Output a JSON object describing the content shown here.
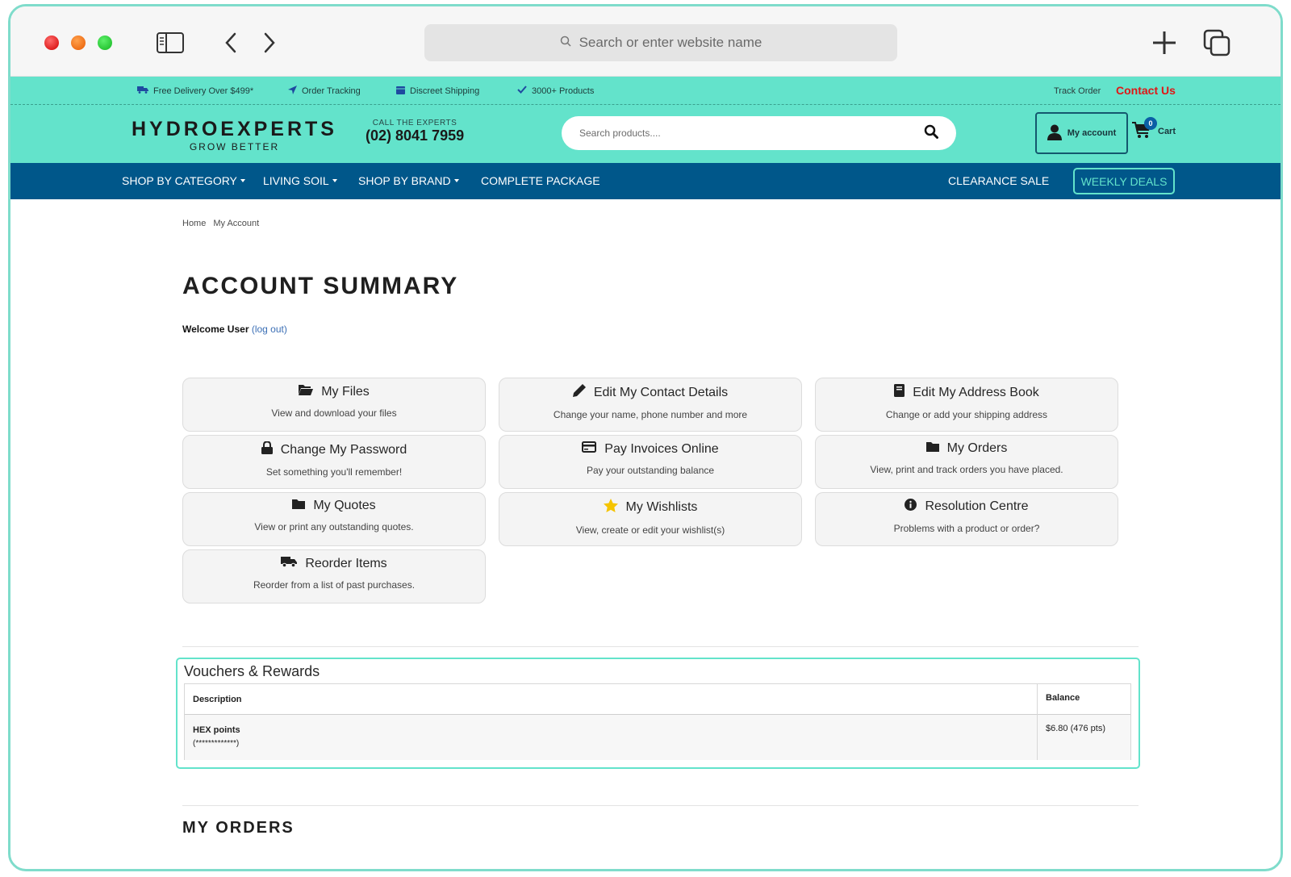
{
  "browser": {
    "address_placeholder": "Search or enter website name"
  },
  "promo": {
    "items": [
      "Free Delivery Over $499*",
      "Order Tracking",
      "Discreet Shipping",
      "3000+ Products"
    ],
    "track_order": "Track Order",
    "contact_us": "Contact Us"
  },
  "header": {
    "logo_name": "HYDROEXPERTS",
    "logo_tag": "GROW BETTER",
    "call_label": "CALL THE EXPERTS",
    "phone": "(02) 8041 7959",
    "search_placeholder": "Search products....",
    "account_label": "My account",
    "cart_label": "Cart",
    "cart_count": "0"
  },
  "nav": {
    "items": [
      "SHOP BY CATEGORY",
      "LIVING SOIL",
      "SHOP BY BRAND",
      "COMPLETE PACKAGE"
    ],
    "clearance": "CLEARANCE SALE",
    "weekly": "WEEKLY DEALS"
  },
  "breadcrumb": [
    "Home",
    "My Account"
  ],
  "page": {
    "title": "ACCOUNT SUMMARY",
    "welcome": "Welcome User",
    "logout": "(log out)"
  },
  "cards": [
    {
      "title": "My Files",
      "desc": "View and download your files",
      "icon": "folder-open-icon"
    },
    {
      "title": "Edit My Contact Details",
      "desc": "Change your name, phone number and more",
      "icon": "pencil-icon"
    },
    {
      "title": "Edit My Address Book",
      "desc": "Change or add your shipping address",
      "icon": "book-icon"
    },
    {
      "title": "Change My Password",
      "desc": "Set something you'll remember!",
      "icon": "lock-icon"
    },
    {
      "title": "Pay Invoices Online",
      "desc": "Pay your outstanding balance",
      "icon": "credit-card-icon"
    },
    {
      "title": "My Orders",
      "desc": "View, print and track orders you have placed.",
      "icon": "folder-icon"
    },
    {
      "title": "My Quotes",
      "desc": "View or print any outstanding quotes.",
      "icon": "folder-icon"
    },
    {
      "title": "My Wishlists",
      "desc": "View, create or edit your wishlist(s)",
      "icon": "star-icon"
    },
    {
      "title": "Resolution Centre",
      "desc": "Problems with a product or order?",
      "icon": "info-icon"
    },
    {
      "title": "Reorder Items",
      "desc": "Reorder from a list of past purchases.",
      "icon": "truck-icon"
    }
  ],
  "vouchers": {
    "title": "Vouchers & Rewards",
    "col_description": "Description",
    "col_balance": "Balance",
    "row_name": "HEX points",
    "row_code": "(*************)",
    "row_balance": "$6.80 (476 pts)"
  },
  "orders_heading": "MY ORDERS",
  "colors": {
    "teal": "#63e3cb",
    "navy": "#00578a",
    "contact_red": "#e01616"
  }
}
